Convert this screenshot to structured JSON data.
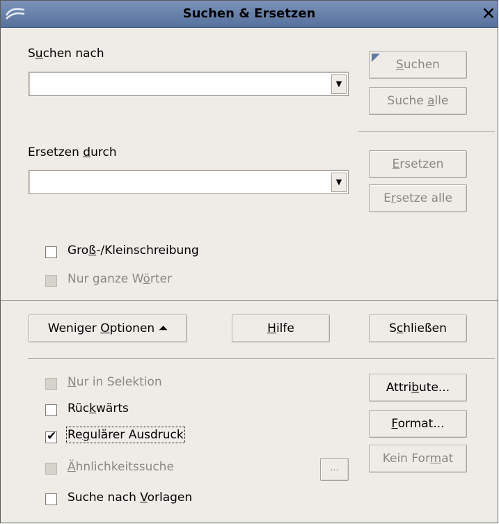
{
  "window": {
    "title": "Suchen & Ersetzen",
    "close_glyph": "✕"
  },
  "search": {
    "label_pre": "S",
    "label_acc": "u",
    "label_post": "chen nach",
    "value": ""
  },
  "replace": {
    "label_pre": "Ersetzen ",
    "label_acc": "d",
    "label_post": "urch",
    "value": ""
  },
  "buttons": {
    "search": {
      "pre": "",
      "acc": "S",
      "post": "uchen"
    },
    "search_all": {
      "pre": "Suche ",
      "acc": "a",
      "post": "lle"
    },
    "replace": {
      "pre": "",
      "acc": "E",
      "post": "rsetzen"
    },
    "replace_all": {
      "pre": "E",
      "acc": "r",
      "post": "setze alle"
    },
    "fewer_options": {
      "pre": "Weniger ",
      "acc": "O",
      "post": "ptionen",
      "icon": "⏶"
    },
    "help": {
      "pre": "",
      "acc": "H",
      "post": "ilfe"
    },
    "close": {
      "pre": "S",
      "acc": "c",
      "post": "hließen"
    },
    "attributes": {
      "pre": "Attri",
      "acc": "b",
      "post": "ute..."
    },
    "format": {
      "pre": "",
      "acc": "F",
      "post": "ormat..."
    },
    "no_format": {
      "pre": "Kein For",
      "acc": "m",
      "post": "at"
    },
    "similarity_dots": "..."
  },
  "options": {
    "match_case": {
      "pre": "Gro",
      "acc": "ß",
      "post": "-/Kleinschreibung",
      "checked": false,
      "enabled": true
    },
    "whole_words": {
      "pre": "Nur ganze W",
      "acc": "ö",
      "post": "rter",
      "checked": false,
      "enabled": false
    },
    "selection_only": {
      "pre": "",
      "acc": "N",
      "post": "ur in Selektion",
      "checked": false,
      "enabled": false
    },
    "backwards": {
      "pre": "Rüc",
      "acc": "k",
      "post": "wärts",
      "checked": false,
      "enabled": true
    },
    "regex": {
      "pre": "Re",
      "acc": "g",
      "post": "ulärer Ausdruck",
      "checked": true,
      "enabled": true,
      "check_glyph": "✔"
    },
    "similarity": {
      "pre": "",
      "acc": "Ä",
      "post": "hnlichkeitssuche",
      "checked": false,
      "enabled": false
    },
    "styles": {
      "pre": "Suche nach ",
      "acc": "V",
      "post": "orlagen",
      "checked": false,
      "enabled": true
    }
  }
}
